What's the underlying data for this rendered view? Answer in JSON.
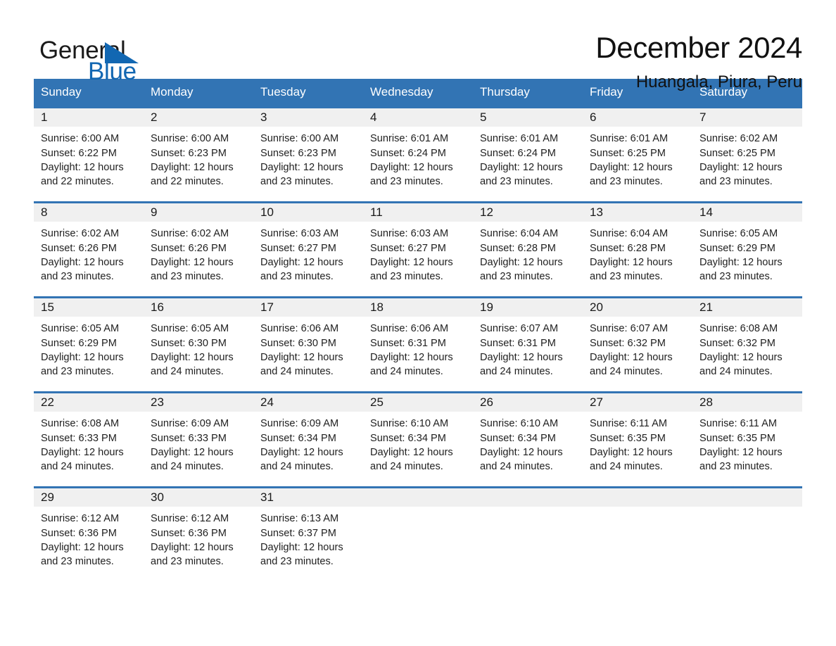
{
  "brand": {
    "name_part1": "General",
    "name_part2": "Blue",
    "flag_icon": "triangle-flag-icon",
    "accent_color": "#1267b2"
  },
  "header": {
    "title": "December 2024",
    "subtitle": "Huangala, Piura, Peru"
  },
  "theme": {
    "header_blue": "#3274b4",
    "daynum_band": "#f0f0f0",
    "text": "#1a1a1a"
  },
  "calendar": {
    "weekdays": [
      "Sunday",
      "Monday",
      "Tuesday",
      "Wednesday",
      "Thursday",
      "Friday",
      "Saturday"
    ],
    "labels": {
      "sunrise": "Sunrise:",
      "sunset": "Sunset:",
      "daylight": "Daylight:"
    },
    "weeks": [
      [
        {
          "day": "1",
          "sunrise": "Sunrise: 6:00 AM",
          "sunset": "Sunset: 6:22 PM",
          "daylight": "Daylight: 12 hours and 22 minutes."
        },
        {
          "day": "2",
          "sunrise": "Sunrise: 6:00 AM",
          "sunset": "Sunset: 6:23 PM",
          "daylight": "Daylight: 12 hours and 22 minutes."
        },
        {
          "day": "3",
          "sunrise": "Sunrise: 6:00 AM",
          "sunset": "Sunset: 6:23 PM",
          "daylight": "Daylight: 12 hours and 23 minutes."
        },
        {
          "day": "4",
          "sunrise": "Sunrise: 6:01 AM",
          "sunset": "Sunset: 6:24 PM",
          "daylight": "Daylight: 12 hours and 23 minutes."
        },
        {
          "day": "5",
          "sunrise": "Sunrise: 6:01 AM",
          "sunset": "Sunset: 6:24 PM",
          "daylight": "Daylight: 12 hours and 23 minutes."
        },
        {
          "day": "6",
          "sunrise": "Sunrise: 6:01 AM",
          "sunset": "Sunset: 6:25 PM",
          "daylight": "Daylight: 12 hours and 23 minutes."
        },
        {
          "day": "7",
          "sunrise": "Sunrise: 6:02 AM",
          "sunset": "Sunset: 6:25 PM",
          "daylight": "Daylight: 12 hours and 23 minutes."
        }
      ],
      [
        {
          "day": "8",
          "sunrise": "Sunrise: 6:02 AM",
          "sunset": "Sunset: 6:26 PM",
          "daylight": "Daylight: 12 hours and 23 minutes."
        },
        {
          "day": "9",
          "sunrise": "Sunrise: 6:02 AM",
          "sunset": "Sunset: 6:26 PM",
          "daylight": "Daylight: 12 hours and 23 minutes."
        },
        {
          "day": "10",
          "sunrise": "Sunrise: 6:03 AM",
          "sunset": "Sunset: 6:27 PM",
          "daylight": "Daylight: 12 hours and 23 minutes."
        },
        {
          "day": "11",
          "sunrise": "Sunrise: 6:03 AM",
          "sunset": "Sunset: 6:27 PM",
          "daylight": "Daylight: 12 hours and 23 minutes."
        },
        {
          "day": "12",
          "sunrise": "Sunrise: 6:04 AM",
          "sunset": "Sunset: 6:28 PM",
          "daylight": "Daylight: 12 hours and 23 minutes."
        },
        {
          "day": "13",
          "sunrise": "Sunrise: 6:04 AM",
          "sunset": "Sunset: 6:28 PM",
          "daylight": "Daylight: 12 hours and 23 minutes."
        },
        {
          "day": "14",
          "sunrise": "Sunrise: 6:05 AM",
          "sunset": "Sunset: 6:29 PM",
          "daylight": "Daylight: 12 hours and 23 minutes."
        }
      ],
      [
        {
          "day": "15",
          "sunrise": "Sunrise: 6:05 AM",
          "sunset": "Sunset: 6:29 PM",
          "daylight": "Daylight: 12 hours and 23 minutes."
        },
        {
          "day": "16",
          "sunrise": "Sunrise: 6:05 AM",
          "sunset": "Sunset: 6:30 PM",
          "daylight": "Daylight: 12 hours and 24 minutes."
        },
        {
          "day": "17",
          "sunrise": "Sunrise: 6:06 AM",
          "sunset": "Sunset: 6:30 PM",
          "daylight": "Daylight: 12 hours and 24 minutes."
        },
        {
          "day": "18",
          "sunrise": "Sunrise: 6:06 AM",
          "sunset": "Sunset: 6:31 PM",
          "daylight": "Daylight: 12 hours and 24 minutes."
        },
        {
          "day": "19",
          "sunrise": "Sunrise: 6:07 AM",
          "sunset": "Sunset: 6:31 PM",
          "daylight": "Daylight: 12 hours and 24 minutes."
        },
        {
          "day": "20",
          "sunrise": "Sunrise: 6:07 AM",
          "sunset": "Sunset: 6:32 PM",
          "daylight": "Daylight: 12 hours and 24 minutes."
        },
        {
          "day": "21",
          "sunrise": "Sunrise: 6:08 AM",
          "sunset": "Sunset: 6:32 PM",
          "daylight": "Daylight: 12 hours and 24 minutes."
        }
      ],
      [
        {
          "day": "22",
          "sunrise": "Sunrise: 6:08 AM",
          "sunset": "Sunset: 6:33 PM",
          "daylight": "Daylight: 12 hours and 24 minutes."
        },
        {
          "day": "23",
          "sunrise": "Sunrise: 6:09 AM",
          "sunset": "Sunset: 6:33 PM",
          "daylight": "Daylight: 12 hours and 24 minutes."
        },
        {
          "day": "24",
          "sunrise": "Sunrise: 6:09 AM",
          "sunset": "Sunset: 6:34 PM",
          "daylight": "Daylight: 12 hours and 24 minutes."
        },
        {
          "day": "25",
          "sunrise": "Sunrise: 6:10 AM",
          "sunset": "Sunset: 6:34 PM",
          "daylight": "Daylight: 12 hours and 24 minutes."
        },
        {
          "day": "26",
          "sunrise": "Sunrise: 6:10 AM",
          "sunset": "Sunset: 6:34 PM",
          "daylight": "Daylight: 12 hours and 24 minutes."
        },
        {
          "day": "27",
          "sunrise": "Sunrise: 6:11 AM",
          "sunset": "Sunset: 6:35 PM",
          "daylight": "Daylight: 12 hours and 24 minutes."
        },
        {
          "day": "28",
          "sunrise": "Sunrise: 6:11 AM",
          "sunset": "Sunset: 6:35 PM",
          "daylight": "Daylight: 12 hours and 23 minutes."
        }
      ],
      [
        {
          "day": "29",
          "sunrise": "Sunrise: 6:12 AM",
          "sunset": "Sunset: 6:36 PM",
          "daylight": "Daylight: 12 hours and 23 minutes."
        },
        {
          "day": "30",
          "sunrise": "Sunrise: 6:12 AM",
          "sunset": "Sunset: 6:36 PM",
          "daylight": "Daylight: 12 hours and 23 minutes."
        },
        {
          "day": "31",
          "sunrise": "Sunrise: 6:13 AM",
          "sunset": "Sunset: 6:37 PM",
          "daylight": "Daylight: 12 hours and 23 minutes."
        },
        {
          "day": "",
          "sunrise": "",
          "sunset": "",
          "daylight": ""
        },
        {
          "day": "",
          "sunrise": "",
          "sunset": "",
          "daylight": ""
        },
        {
          "day": "",
          "sunrise": "",
          "sunset": "",
          "daylight": ""
        },
        {
          "day": "",
          "sunrise": "",
          "sunset": "",
          "daylight": ""
        }
      ]
    ]
  }
}
